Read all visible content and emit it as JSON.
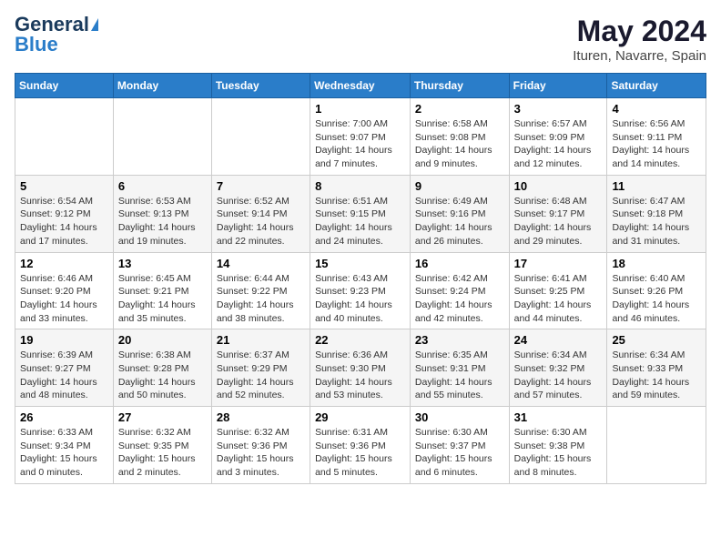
{
  "logo": {
    "line1": "General",
    "line2": "Blue"
  },
  "title": "May 2024",
  "subtitle": "Ituren, Navarre, Spain",
  "days_of_week": [
    "Sunday",
    "Monday",
    "Tuesday",
    "Wednesday",
    "Thursday",
    "Friday",
    "Saturday"
  ],
  "weeks": [
    [
      {
        "day": "",
        "info": ""
      },
      {
        "day": "",
        "info": ""
      },
      {
        "day": "",
        "info": ""
      },
      {
        "day": "1",
        "info": "Sunrise: 7:00 AM\nSunset: 9:07 PM\nDaylight: 14 hours\nand 7 minutes."
      },
      {
        "day": "2",
        "info": "Sunrise: 6:58 AM\nSunset: 9:08 PM\nDaylight: 14 hours\nand 9 minutes."
      },
      {
        "day": "3",
        "info": "Sunrise: 6:57 AM\nSunset: 9:09 PM\nDaylight: 14 hours\nand 12 minutes."
      },
      {
        "day": "4",
        "info": "Sunrise: 6:56 AM\nSunset: 9:11 PM\nDaylight: 14 hours\nand 14 minutes."
      }
    ],
    [
      {
        "day": "5",
        "info": "Sunrise: 6:54 AM\nSunset: 9:12 PM\nDaylight: 14 hours\nand 17 minutes."
      },
      {
        "day": "6",
        "info": "Sunrise: 6:53 AM\nSunset: 9:13 PM\nDaylight: 14 hours\nand 19 minutes."
      },
      {
        "day": "7",
        "info": "Sunrise: 6:52 AM\nSunset: 9:14 PM\nDaylight: 14 hours\nand 22 minutes."
      },
      {
        "day": "8",
        "info": "Sunrise: 6:51 AM\nSunset: 9:15 PM\nDaylight: 14 hours\nand 24 minutes."
      },
      {
        "day": "9",
        "info": "Sunrise: 6:49 AM\nSunset: 9:16 PM\nDaylight: 14 hours\nand 26 minutes."
      },
      {
        "day": "10",
        "info": "Sunrise: 6:48 AM\nSunset: 9:17 PM\nDaylight: 14 hours\nand 29 minutes."
      },
      {
        "day": "11",
        "info": "Sunrise: 6:47 AM\nSunset: 9:18 PM\nDaylight: 14 hours\nand 31 minutes."
      }
    ],
    [
      {
        "day": "12",
        "info": "Sunrise: 6:46 AM\nSunset: 9:20 PM\nDaylight: 14 hours\nand 33 minutes."
      },
      {
        "day": "13",
        "info": "Sunrise: 6:45 AM\nSunset: 9:21 PM\nDaylight: 14 hours\nand 35 minutes."
      },
      {
        "day": "14",
        "info": "Sunrise: 6:44 AM\nSunset: 9:22 PM\nDaylight: 14 hours\nand 38 minutes."
      },
      {
        "day": "15",
        "info": "Sunrise: 6:43 AM\nSunset: 9:23 PM\nDaylight: 14 hours\nand 40 minutes."
      },
      {
        "day": "16",
        "info": "Sunrise: 6:42 AM\nSunset: 9:24 PM\nDaylight: 14 hours\nand 42 minutes."
      },
      {
        "day": "17",
        "info": "Sunrise: 6:41 AM\nSunset: 9:25 PM\nDaylight: 14 hours\nand 44 minutes."
      },
      {
        "day": "18",
        "info": "Sunrise: 6:40 AM\nSunset: 9:26 PM\nDaylight: 14 hours\nand 46 minutes."
      }
    ],
    [
      {
        "day": "19",
        "info": "Sunrise: 6:39 AM\nSunset: 9:27 PM\nDaylight: 14 hours\nand 48 minutes."
      },
      {
        "day": "20",
        "info": "Sunrise: 6:38 AM\nSunset: 9:28 PM\nDaylight: 14 hours\nand 50 minutes."
      },
      {
        "day": "21",
        "info": "Sunrise: 6:37 AM\nSunset: 9:29 PM\nDaylight: 14 hours\nand 52 minutes."
      },
      {
        "day": "22",
        "info": "Sunrise: 6:36 AM\nSunset: 9:30 PM\nDaylight: 14 hours\nand 53 minutes."
      },
      {
        "day": "23",
        "info": "Sunrise: 6:35 AM\nSunset: 9:31 PM\nDaylight: 14 hours\nand 55 minutes."
      },
      {
        "day": "24",
        "info": "Sunrise: 6:34 AM\nSunset: 9:32 PM\nDaylight: 14 hours\nand 57 minutes."
      },
      {
        "day": "25",
        "info": "Sunrise: 6:34 AM\nSunset: 9:33 PM\nDaylight: 14 hours\nand 59 minutes."
      }
    ],
    [
      {
        "day": "26",
        "info": "Sunrise: 6:33 AM\nSunset: 9:34 PM\nDaylight: 15 hours\nand 0 minutes."
      },
      {
        "day": "27",
        "info": "Sunrise: 6:32 AM\nSunset: 9:35 PM\nDaylight: 15 hours\nand 2 minutes."
      },
      {
        "day": "28",
        "info": "Sunrise: 6:32 AM\nSunset: 9:36 PM\nDaylight: 15 hours\nand 3 minutes."
      },
      {
        "day": "29",
        "info": "Sunrise: 6:31 AM\nSunset: 9:36 PM\nDaylight: 15 hours\nand 5 minutes."
      },
      {
        "day": "30",
        "info": "Sunrise: 6:30 AM\nSunset: 9:37 PM\nDaylight: 15 hours\nand 6 minutes."
      },
      {
        "day": "31",
        "info": "Sunrise: 6:30 AM\nSunset: 9:38 PM\nDaylight: 15 hours\nand 8 minutes."
      },
      {
        "day": "",
        "info": ""
      }
    ]
  ]
}
